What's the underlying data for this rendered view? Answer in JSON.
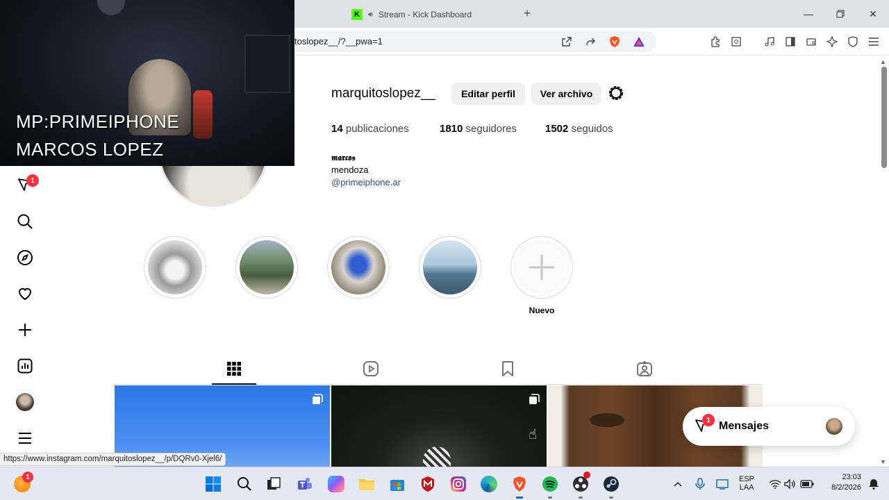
{
  "browser": {
    "tab_title": "Stream - Kick Dashboard",
    "tab_icon": "K",
    "url": "toslopez__/?__pwa=1",
    "status_url": "https://www.instagram.com/marquitoslopez__/p/DQRv0-Xjel6/"
  },
  "webcam": {
    "line1": "MP:PRIMEIPHONE",
    "line2": "MARCOS LOPEZ"
  },
  "profile": {
    "username": "marquitoslopez__",
    "edit_label": "Editar perfil",
    "archive_label": "Ver archivo",
    "stats": [
      {
        "count": "14",
        "label": "publicaciones"
      },
      {
        "count": "1810",
        "label": "seguidores"
      },
      {
        "count": "1502",
        "label": "seguidos"
      }
    ],
    "bio_name": "𝖒𝖆𝖗𝖈𝖔𝖘",
    "bio_location": "mendoza",
    "bio_link": "@primeiphone.ar"
  },
  "highlights": {
    "new_label": "Nuevo"
  },
  "sidebar": {
    "messages_badge": "1"
  },
  "messages": {
    "label": "Mensajes",
    "badge": "1"
  },
  "taskbar": {
    "lang_top": "ESP",
    "lang_bottom": "LAA",
    "time": "23:03",
    "date": "8/2/2026",
    "app_badge": "1"
  },
  "colors": {
    "kick_green": "#53fc18",
    "link_blue": "#324c8e",
    "badge_red": "#ff3040"
  }
}
